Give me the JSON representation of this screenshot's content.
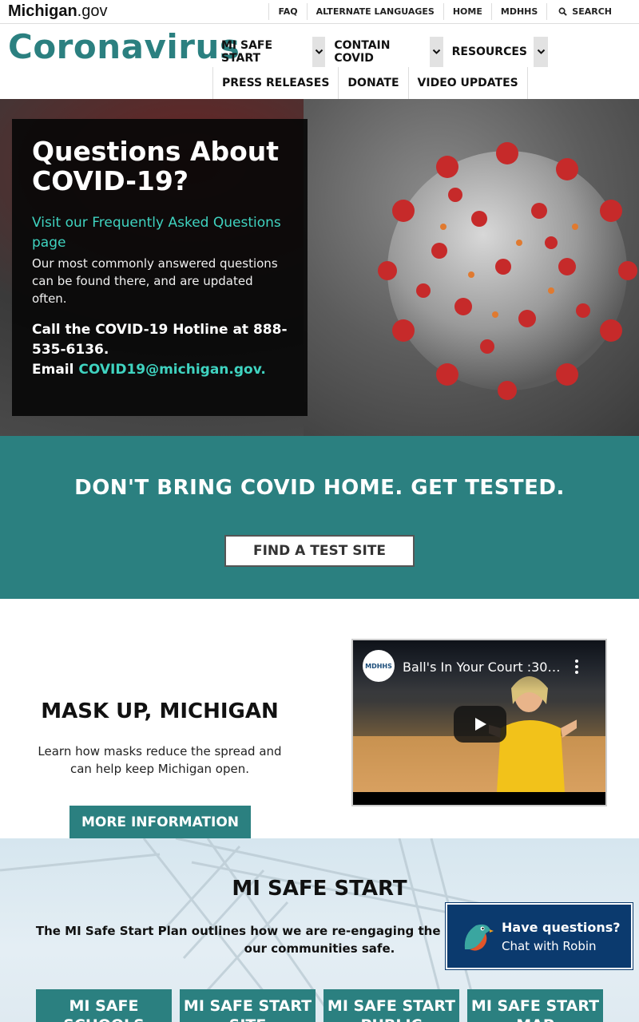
{
  "util": {
    "logo_brand": "Michigan",
    "logo_suffix": ".gov",
    "links": [
      "FAQ",
      "ALTERNATE LANGUAGES",
      "HOME",
      "MDHHS"
    ],
    "search_label": "SEARCH"
  },
  "header": {
    "site_title": "Coronavirus",
    "nav_primary": [
      "MI SAFE START",
      "CONTAIN COVID",
      "RESOURCES"
    ],
    "nav_secondary": [
      "PRESS RELEASES",
      "DONATE",
      "VIDEO UPDATES"
    ]
  },
  "hero": {
    "title": "Questions About COVID-19?",
    "faq_link": "Visit our Frequently Asked Questions page",
    "faq_desc": "Our most commonly answered questions can be found there, and are updated often.",
    "hotline": "Call the COVID-19 Hotline at 888-535-6136.",
    "email_prefix": "Email ",
    "email": "COVID19@michigan.gov."
  },
  "testing": {
    "headline": "DON'T BRING COVID HOME. GET TESTED.",
    "button": "FIND A TEST SITE"
  },
  "mask": {
    "title": "MASK UP, MICHIGAN",
    "desc": "Learn how masks reduce the spread and can help keep Michigan open.",
    "button": "MORE INFORMATION",
    "video_title": "Ball's In Your Court :30 ...",
    "video_logo": "MDHHS"
  },
  "safe_start": {
    "title": "MI SAFE START",
    "desc": "The MI Safe Start Plan outlines how we are re-engaging the economy while keeping our communities safe.",
    "tiles": [
      "MI SAFE SCHOOLS",
      "MI SAFE START SITE",
      "MI SAFE START PUBLIC",
      "MI SAFE START MAP"
    ]
  },
  "chat": {
    "question": "Have questions?",
    "cta": "Chat with Robin"
  },
  "colors": {
    "teal": "#2b8080",
    "link_teal": "#3fd3c0",
    "chat_navy": "#0b3a6e"
  },
  "icons": [
    "search-icon",
    "chevron-down-icon",
    "play-icon",
    "kebab-menu-icon",
    "robin-bird-icon"
  ]
}
